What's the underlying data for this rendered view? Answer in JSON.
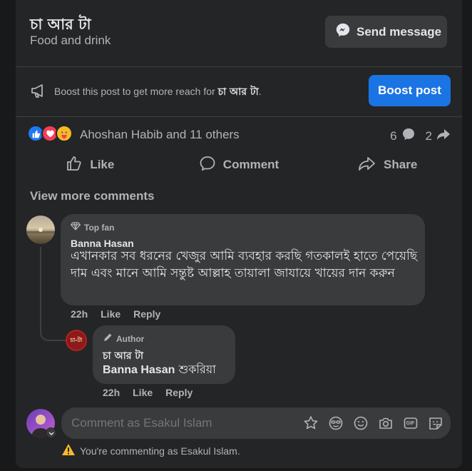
{
  "page": {
    "name": "চা আর টা",
    "category": "Food and drink",
    "send_message_label": "Send message"
  },
  "boost": {
    "text_prefix": "Boost this post to get more reach for ",
    "page_name": "চা আর টা",
    "text_suffix": ".",
    "button_label": "Boost post"
  },
  "reactions": {
    "names": "Ahoshan Habib and 11 others",
    "comment_count": "6",
    "share_count": "2",
    "icons": [
      "like-icon",
      "love-icon",
      "care-icon"
    ]
  },
  "actions": {
    "like": "Like",
    "comment": "Comment",
    "share": "Share"
  },
  "view_more_comments": "View more comments",
  "comments": [
    {
      "badge": "Top fan",
      "name": "Banna Hasan",
      "text": "এখানকার সব ধরনের খেজুর আমি ব্যবহার করছি গতকালই হাতে পেয়েছি দাম এবং মানে আমি সন্তুষ্ট আল্লাহ তায়ালা জাযায়ে খায়ের দান করুন",
      "time": "22h",
      "like": "Like",
      "reply": "Reply"
    },
    {
      "badge": "Author",
      "name": "চা আর টা",
      "mention": "Banna Hasan",
      "text": " শুকরিয়া",
      "time": "22h",
      "like": "Like",
      "reply": "Reply"
    }
  ],
  "composer": {
    "placeholder": "Comment as Esakul Islam",
    "tools": [
      "avatar-sticker-icon",
      "emoji-face-icon",
      "smiley-icon",
      "camera-icon",
      "gif-icon",
      "sticker-icon"
    ],
    "gif_label": "GIF",
    "notice": "You're commenting as Esakul Islam."
  },
  "colors": {
    "accent": "#1b74e4",
    "background": "#242526",
    "bubble": "#3a3b3c",
    "like_blue": "#2078f4",
    "love_red": "#f33e58",
    "warning": "#f7b928"
  }
}
